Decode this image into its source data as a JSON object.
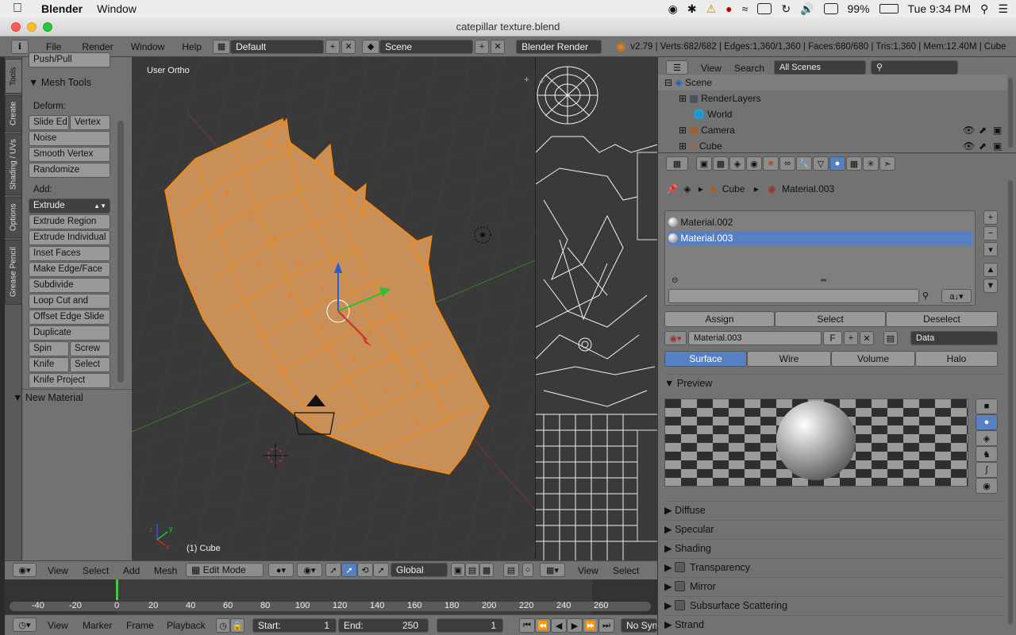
{
  "macbar": {
    "app": "Blender",
    "menu": "Window",
    "battery": "99%",
    "clock": "Tue 9:34 PM"
  },
  "window": {
    "title": "catepillar texture.blend"
  },
  "header": {
    "menus": [
      "File",
      "Render",
      "Window",
      "Help"
    ],
    "layout": "Default",
    "scene": "Scene",
    "engine": "Blender Render",
    "stats": "v2.79 | Verts:682/682 | Edges:1,360/1,360 | Faces:680/680 | Tris:1,360 | Mem:12.40M | Cube"
  },
  "tools": {
    "tabs": [
      "Tools",
      "Create",
      "Shading / UVs",
      "Options",
      "Grease Pencil"
    ],
    "top_button": "Push/Pull",
    "panel_title": "Mesh Tools",
    "deform_label": "Deform:",
    "deform": {
      "slide_edge": "Slide Ed",
      "vertex": "Vertex",
      "noise": "Noise",
      "smooth_vertex": "Smooth Vertex",
      "randomize": "Randomize"
    },
    "add_label": "Add:",
    "add": {
      "extrude": "Extrude",
      "extrude_region": "Extrude Region",
      "extrude_individual": "Extrude Individual",
      "inset_faces": "Inset Faces",
      "make_edge_face": "Make Edge/Face",
      "subdivide": "Subdivide",
      "loop_cut": "Loop Cut and Slide",
      "offset_edge": "Offset Edge Slide",
      "duplicate": "Duplicate",
      "spin": "Spin",
      "screw": "Screw",
      "knife": "Knife",
      "select": "Select",
      "knife_project": "Knife Project"
    },
    "new_material": "New Material"
  },
  "viewport": {
    "view_name": "User Ortho",
    "object_label": "(1) Cube"
  },
  "outliner": {
    "menus": [
      "View",
      "Search"
    ],
    "filter": "All Scenes",
    "search_placeholder": "",
    "items": [
      "Scene",
      "RenderLayers",
      "World",
      "Camera",
      "Cube"
    ]
  },
  "properties": {
    "breadcrumb_object": "Cube",
    "breadcrumb_material": "Material.003",
    "slots": [
      "Material.002",
      "Material.003"
    ],
    "assign": "Assign",
    "select": "Select",
    "deselect": "Deselect",
    "material_name": "Material.003",
    "fake_user": "F",
    "link": "Data",
    "tabs": [
      "Surface",
      "Wire",
      "Volume",
      "Halo"
    ],
    "preview_title": "Preview",
    "sections": [
      "Diffuse",
      "Specular",
      "Shading",
      "Transparency",
      "Mirror",
      "Subsurface Scattering",
      "Strand"
    ]
  },
  "viewport_header": {
    "menus": [
      "View",
      "Select",
      "Add",
      "Mesh"
    ],
    "mode": "Edit Mode",
    "orientation": "Global",
    "uv_menus": [
      "View",
      "Select"
    ]
  },
  "timeline": {
    "ticks": [
      "-40",
      "-20",
      "0",
      "20",
      "40",
      "60",
      "80",
      "100",
      "120",
      "140",
      "160",
      "180",
      "200",
      "220",
      "240",
      "260"
    ],
    "menus": [
      "View",
      "Marker",
      "Frame",
      "Playback"
    ],
    "start_label": "Start:",
    "start": "1",
    "end_label": "End:",
    "end": "250",
    "current": "1",
    "sync": "No Sync"
  }
}
